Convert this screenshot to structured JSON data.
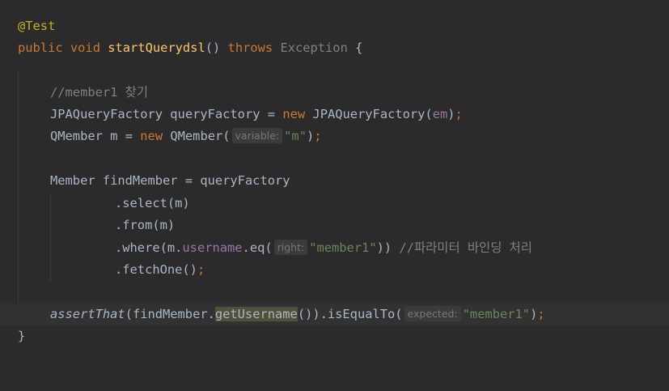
{
  "lines": {
    "l1": {
      "annotation": "@Test"
    },
    "l2": {
      "kw_public": "public",
      "kw_void": "void",
      "method": "startQuerydsl",
      "parens": "()",
      "kw_throws": "throws",
      "exception": "Exception",
      "brace": "{"
    },
    "l4": {
      "comment": "//member1 찾기"
    },
    "l5": {
      "type": "JPAQueryFactory",
      "var": "queryFactory",
      "eq": "=",
      "kw_new": "new",
      "ctor": "JPAQueryFactory(",
      "arg": "em",
      "close": ")",
      "semi": ";"
    },
    "l6": {
      "type": "QMember",
      "var": "m",
      "eq": "=",
      "kw_new": "new",
      "ctor": "QMember(",
      "hint": "variable:",
      "str": "\"m\"",
      "close": ")",
      "semi": ";"
    },
    "l8": {
      "text": "Member findMember = queryFactory"
    },
    "l9": {
      "text": ".select(m)"
    },
    "l10": {
      "text": ".from(m)"
    },
    "l11": {
      "pre": ".where(m.",
      "field": "username",
      "mid": ".eq(",
      "hint": "right:",
      "str": "\"member1\"",
      "post": "))",
      "comment": "//파라미터 바인딩 처리"
    },
    "l12": {
      "text": ".fetchOne()",
      "semi": ";"
    },
    "l14": {
      "call": "assertThat",
      "pre": "(findMember.",
      "getter": "getUsername",
      "mid": "()).isEqualTo(",
      "hint": "expected:",
      "str": "\"member1\"",
      "close": ")",
      "semi": ";"
    },
    "l15": {
      "brace": "}"
    }
  }
}
